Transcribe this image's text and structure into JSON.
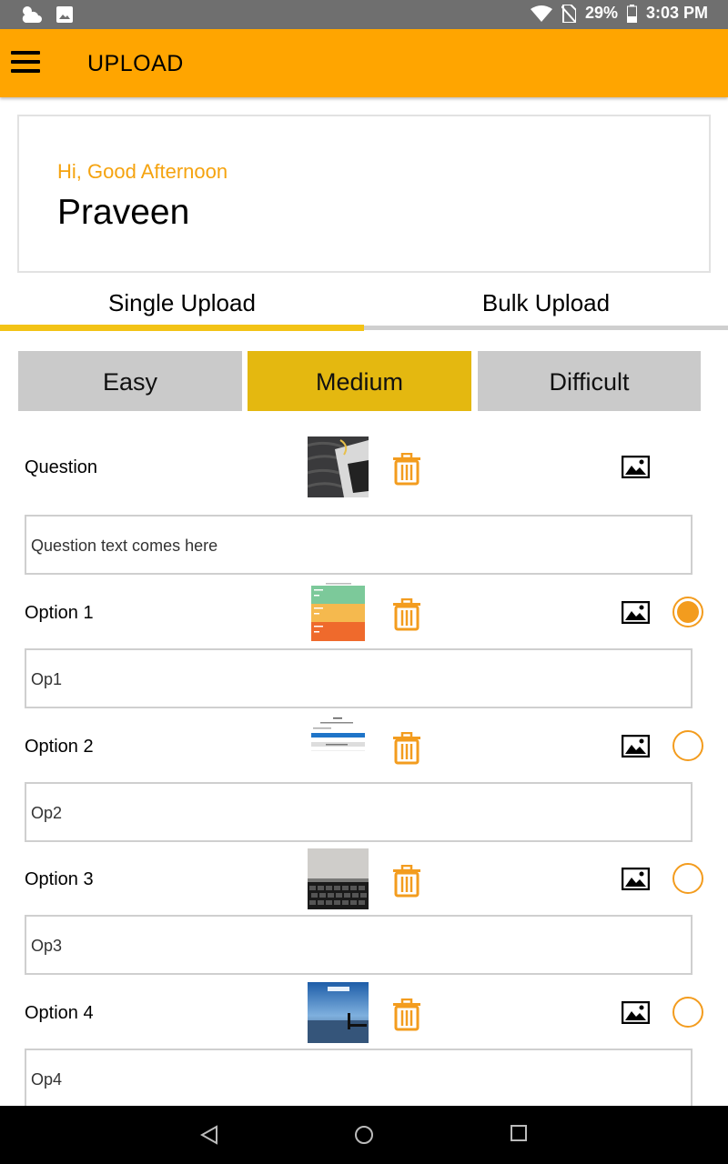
{
  "status_bar": {
    "icons_left": [
      "weather-icon",
      "image-notification-icon"
    ],
    "battery": "29%",
    "time": "3:03 PM"
  },
  "app_bar": {
    "title": "UPLOAD"
  },
  "greeting_card": {
    "greeting": "Hi, Good Afternoon",
    "name": "Praveen"
  },
  "tabs": [
    {
      "label": "Single Upload",
      "active": true
    },
    {
      "label": "Bulk Upload",
      "active": false
    }
  ],
  "difficulty": [
    {
      "label": "Easy",
      "selected": false
    },
    {
      "label": "Medium",
      "selected": true
    },
    {
      "label": "Difficult",
      "selected": false
    }
  ],
  "question": {
    "label": "Question",
    "text": "Question text comes here"
  },
  "options": [
    {
      "label": "Option 1",
      "text": "Op1",
      "correct": true
    },
    {
      "label": "Option 2",
      "text": "Op2",
      "correct": false
    },
    {
      "label": "Option 3",
      "text": "Op3",
      "correct": false
    },
    {
      "label": "Option 4",
      "text": "Op4",
      "correct": false
    }
  ],
  "colors": {
    "app_bar": "#ffa500",
    "greeting_text": "#f5a30f",
    "tab_active_underline": "#f3c316",
    "difficulty_selected": "#e4b810",
    "difficulty_unselected": "#cacaca",
    "accent_icons": "#f39c1e"
  },
  "icons": {
    "delete": "trash-icon",
    "pick_image": "gallery-icon",
    "menu": "hamburger-menu-icon"
  }
}
